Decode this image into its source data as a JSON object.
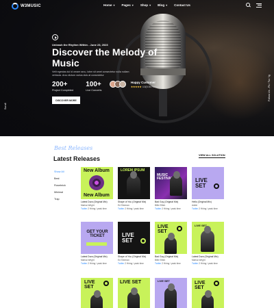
{
  "nav": {
    "logo": "W3MUSIC",
    "items": [
      {
        "label": "Home",
        "caret": "▾"
      },
      {
        "label": "Pages",
        "caret": "▾"
      },
      {
        "label": "Shop",
        "caret": "▾"
      },
      {
        "label": "Blog",
        "caret": "▾"
      },
      {
        "label": "Contact Us",
        "caret": ""
      }
    ]
  },
  "hero": {
    "tagline": "Unleash the Rhythm Within - June 23, 2023",
    "title": "Discover the Melody of Music",
    "description": "Velit egestas dui id ornare arcu, lobm sit amet consectetur nulla nullam vehicula. Arcu dictum varius duis at consectetur",
    "stats": [
      {
        "value": "200+",
        "label": "Project Completed"
      },
      {
        "value": "100+",
        "label": "Live Concerts"
      }
    ],
    "customers": {
      "name": "Happy Customer",
      "stars": "★★★★★",
      "rating": "4.8(5.5k Reviews)"
    },
    "button": "DISCOVER MORE",
    "scroll_label": "Scroll",
    "hours_label": "Follow Us - Fb / Tw / Ig"
  },
  "releases": {
    "script_title": "Best Releases",
    "title": "Latest Releases",
    "view_all": "VIEW ALL SOLUTION",
    "genres": [
      "Show All",
      "Best",
      "Rosebrick",
      "Minimal",
      "Trap"
    ],
    "cards": [
      {
        "cover_text": "New Album",
        "title": "Latest Dura (Original Mix)",
        "artist": "Marisa Wright",
        "meta": "Twitter 2 Hiring / peak time"
      },
      {
        "cover_text": "LOREM IPSUM",
        "title": "Shape of You (Original Mix)",
        "artist": "Ed Sheeran",
        "meta": "Twitter 2 Hiring / peak time"
      },
      {
        "cover_text": "MUSIC FESTIVAL",
        "title": "Bad Guy (Original Mix)",
        "artist": "Billie Eilish",
        "meta": "Twitter 2 Hiring / peak time"
      },
      {
        "cover_text": "LIVE SET",
        "title": "Hello (Original Mix)",
        "artist": "Adele",
        "meta": "Twitter 2 Hiring / peak time"
      },
      {
        "cover_text": "GET YOUR TICKET",
        "title": "Latest Dura (Original Mix)",
        "artist": "Marisa Wright",
        "meta": "Twitter 2 Hiring / peak time"
      },
      {
        "cover_text": "LIVE SET",
        "title": "Shape of You (Original Mix)",
        "artist": "Ed Sheeran",
        "meta": "Twitter 2 Hiring / peak time"
      },
      {
        "cover_text": "LIVE SET",
        "title": "Bad Guy (Original Mix)",
        "artist": "Billie Eilish",
        "meta": "Twitter 2 Hiring / peak time"
      },
      {
        "cover_text": "LIVE SET",
        "title": "Latest Dura (Original Mix)",
        "artist": "Marisa Wright",
        "meta": "Twitter 2 Hiring / peak time"
      },
      {
        "cover_text": "LIVE SET",
        "title": "",
        "artist": "",
        "meta": ""
      },
      {
        "cover_text": "LIVE SET",
        "title": "",
        "artist": "",
        "meta": ""
      },
      {
        "cover_text": "LIVE SET",
        "title": "",
        "artist": "",
        "meta": ""
      },
      {
        "cover_text": "LIVE SET",
        "title": "",
        "artist": "",
        "meta": ""
      }
    ]
  },
  "colors": {
    "accent": "#2f8cff",
    "lime": "#c8f25a",
    "lavender": "#b8a8f0",
    "dark": "#111111"
  }
}
